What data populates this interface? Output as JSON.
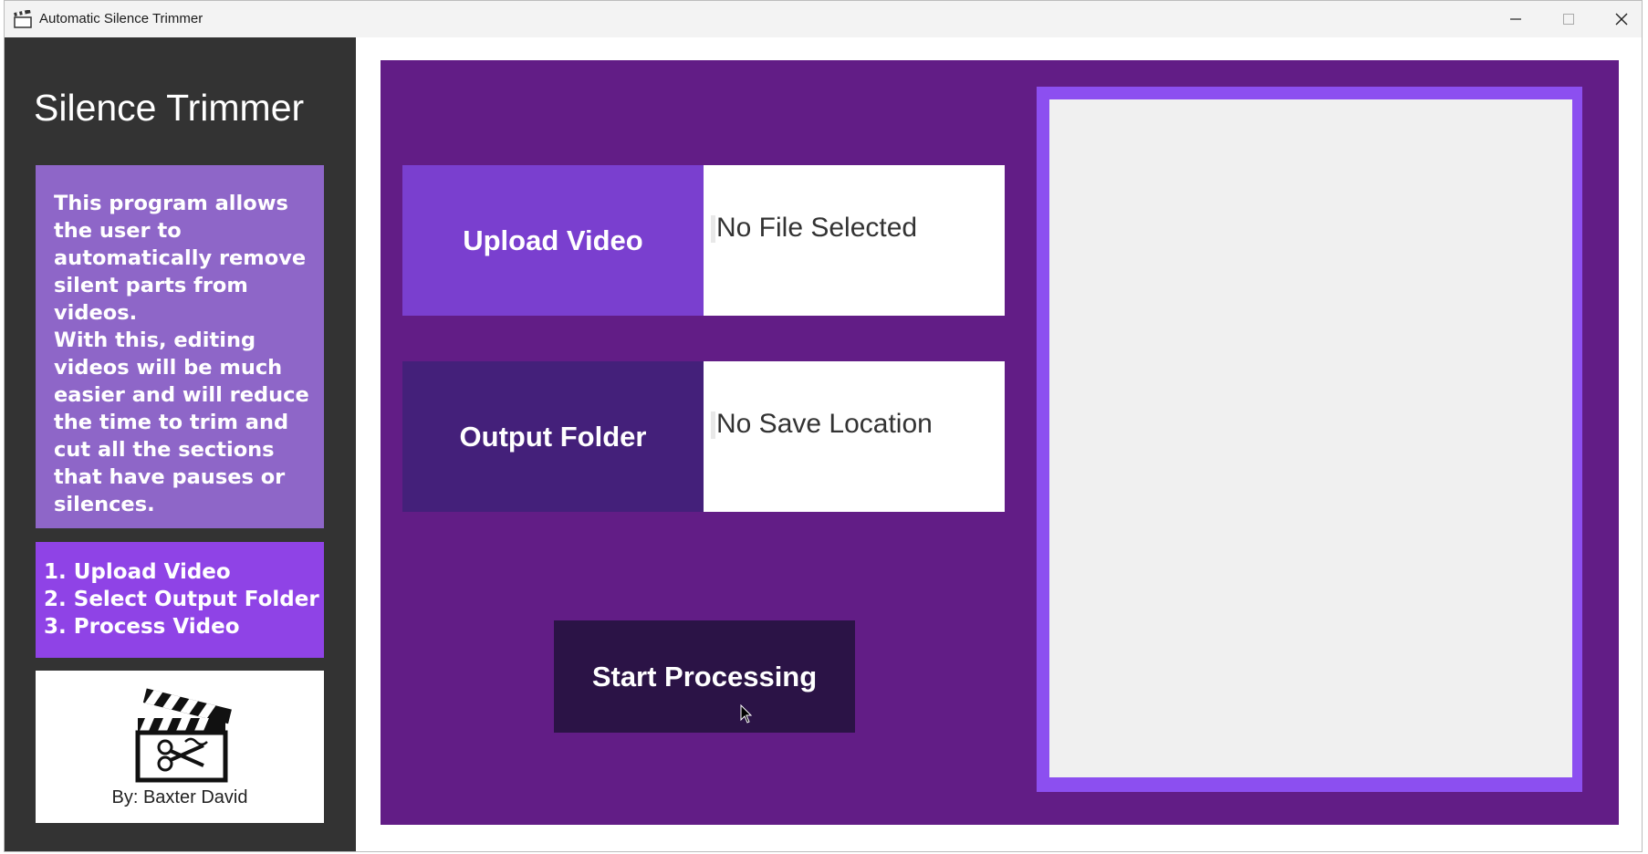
{
  "window": {
    "title": "Automatic Silence Trimmer",
    "app_icon": "clapperboard-icon",
    "controls": [
      "minimize-icon",
      "maximize-icon",
      "close-icon"
    ]
  },
  "sidebar": {
    "title": "Silence Trimmer",
    "description": "This program allows the user to automatically remove silent parts from videos.\nWith this, editing videos will be much easier and will reduce the time to trim and cut all the sections that have pauses or silences.",
    "steps": [
      "1. Upload Video",
      "2. Select Output Folder",
      "3. Process Video"
    ],
    "logo_icon": "clapperboard-scissors-icon",
    "author": "By: Baxter David"
  },
  "main": {
    "upload": {
      "label": "Upload Video",
      "value": "No File Selected"
    },
    "output": {
      "label": "Output Folder",
      "value": "No Save Location"
    },
    "start_button": "Start Processing"
  },
  "colors": {
    "sidebar_bg": "#333333",
    "description_bg": "#8e66c8",
    "steps_bg": "#8f43e6",
    "panel_bg": "#621d86",
    "upload_label_bg": "#7a3fcf",
    "output_label_bg": "#44207a",
    "start_button_bg": "#2b1346",
    "preview_border": "#8c4ff0"
  }
}
